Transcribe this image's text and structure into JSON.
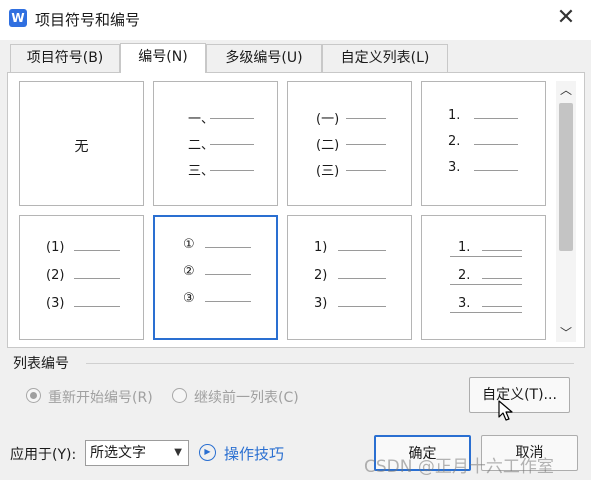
{
  "window": {
    "title": "项目符号和编号",
    "app_icon": "W",
    "close_glyph": "✕"
  },
  "tabs": [
    {
      "label": "项目符号(B)",
      "active": false
    },
    {
      "label": "编号(N)",
      "active": true
    },
    {
      "label": "多级编号(U)",
      "active": false
    },
    {
      "label": "自定义列表(L)",
      "active": false
    }
  ],
  "gallery": {
    "none_label": "无",
    "styles": [
      {
        "markers": [
          "一、",
          "二、",
          "三、"
        ]
      },
      {
        "markers": [
          "(一)",
          "(二)",
          "(三)"
        ]
      },
      {
        "markers": [
          "1.",
          "2.",
          "3."
        ]
      },
      {
        "markers": [
          "(1)",
          "(2)",
          "(3)"
        ]
      },
      {
        "markers": [
          "①",
          "②",
          "③"
        ],
        "selected": true
      },
      {
        "markers": [
          "1)",
          "2)",
          "3)"
        ]
      },
      {
        "markers": [
          "1.",
          "2.",
          "3."
        ]
      }
    ]
  },
  "list_numbering": {
    "section_label": "列表编号",
    "restart_label": "重新开始编号(R)",
    "continue_label": "继续前一列表(C)",
    "custom_button": "自定义(T)..."
  },
  "footer": {
    "apply_label": "应用于(Y):",
    "apply_value": "所选文字",
    "tips_label": "操作技巧",
    "ok_button": "确定",
    "cancel_button": "取消"
  },
  "watermark": "CSDN @正月十六工作室",
  "colors": {
    "accent": "#2a6fd1",
    "disabled_text": "#a0a0a0"
  }
}
